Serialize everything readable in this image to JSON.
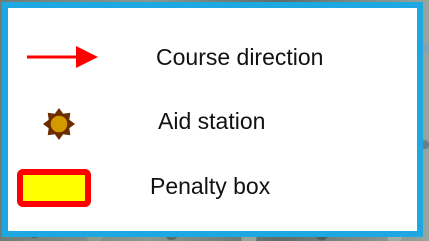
{
  "legend": {
    "items": [
      {
        "symbol": "red-arrow-icon",
        "label": "Course direction",
        "color": "#ff0000"
      },
      {
        "symbol": "sunburst-icon",
        "label": "Aid station",
        "fill": "#d39a00",
        "stroke": "#6b2d00"
      },
      {
        "symbol": "penalty-box-icon",
        "label": "Penalty box",
        "fill": "#ffff00",
        "stroke": "#ff0000"
      }
    ],
    "border_color": "#1ea7e1"
  }
}
